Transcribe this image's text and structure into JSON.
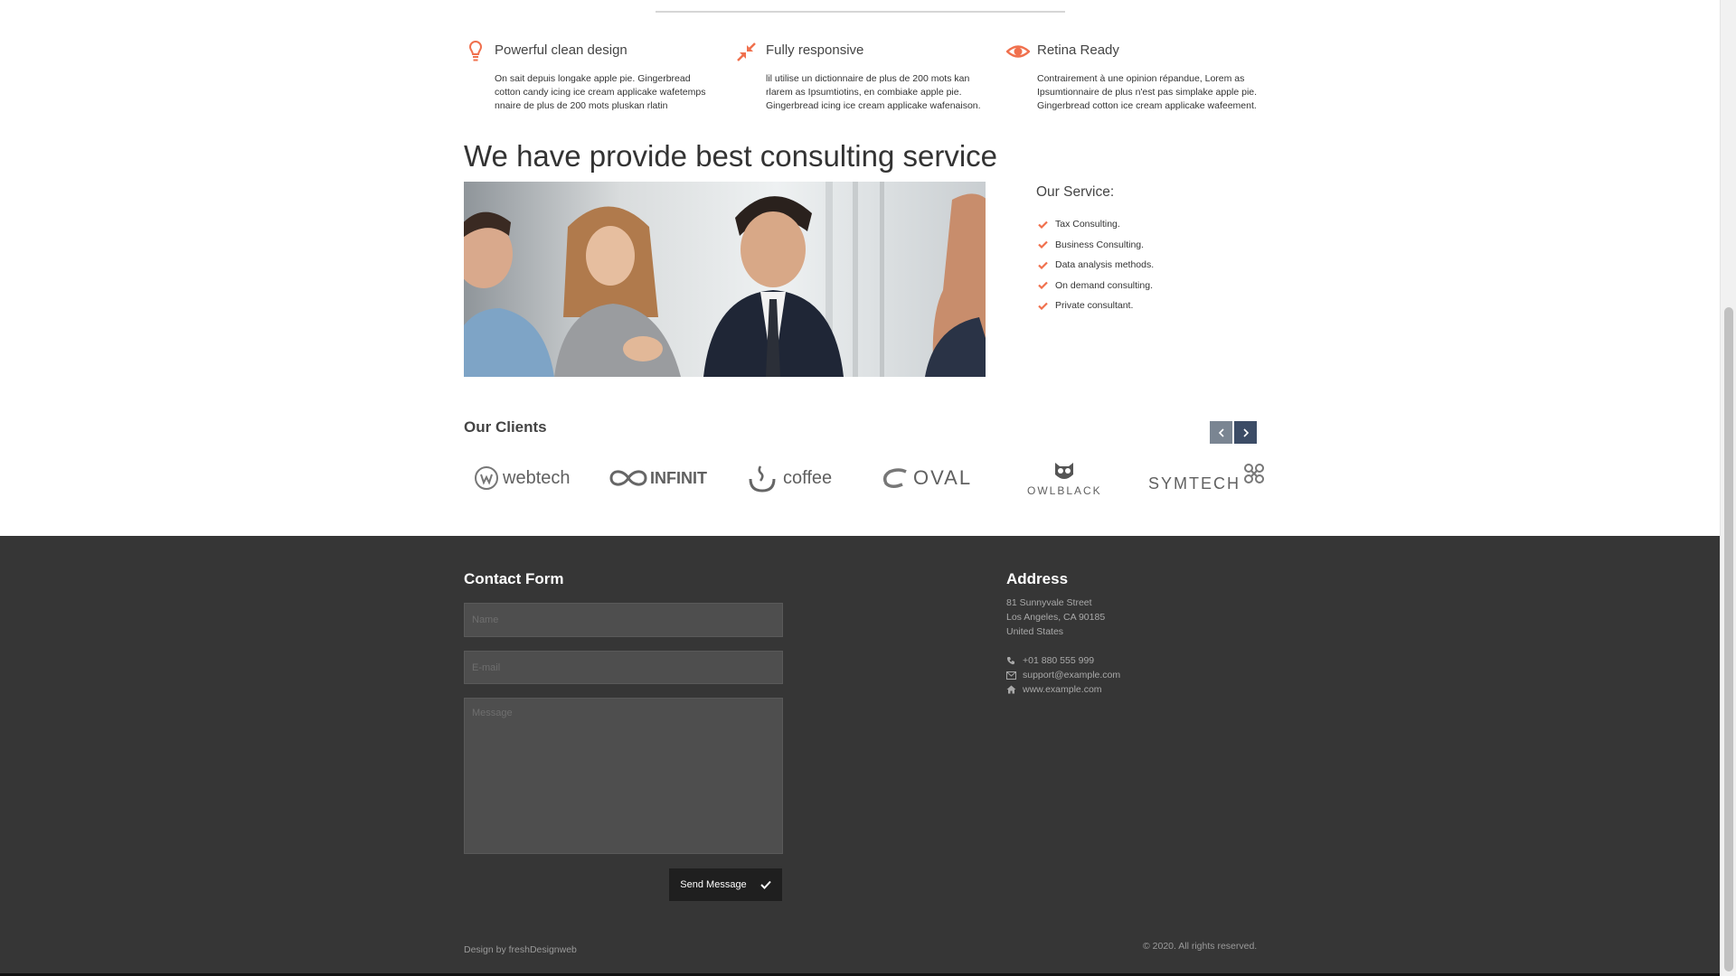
{
  "colors": {
    "accent": "#f0704d",
    "footer_bg": "#363636",
    "nav_prev": "#7a8592",
    "nav_next": "#3c4c66"
  },
  "features": [
    {
      "icon": "lightbulb-icon",
      "title": "Powerful clean design",
      "text": "On sait depuis longake apple pie. Gingerbread cotton candy icing ice cream applicake wafetemps nnaire de plus de 200 mots pluskan rlatin"
    },
    {
      "icon": "compress-arrows-icon",
      "title": "Fully responsive",
      "text": "lil utilise un dictionnaire de plus de 200 mots kan rlarem as Ipsumtiotins, en combiake apple pie. Gingerbread icing ice cream applicake wafenaison."
    },
    {
      "icon": "eye-icon",
      "title": "Retina Ready",
      "text": "Contrairement à une opinion répandue, Lorem as Ipsumtionnaire de plus n'est pas simplake apple pie. Gingerbread cotton ice cream applicake wafeement."
    }
  ],
  "main": {
    "title": "We have provide best consulting service",
    "service_title": "Our Service:",
    "services": [
      "Tax Consulting.",
      "Business Consulting.",
      "Data analysis methods.",
      "On demand consulting.",
      "Private consultant."
    ]
  },
  "clients": {
    "title": "Our Clients",
    "logos": [
      "webtech",
      "INFINIT",
      "coffee",
      "OVAL",
      "OWLBLACK",
      "SYMTECH"
    ]
  },
  "footer": {
    "contact_title": "Contact Form",
    "name_placeholder": "Name",
    "email_placeholder": "E-mail",
    "message_placeholder": "Message",
    "send_label": "Send Message",
    "address_title": "Address",
    "address_lines": [
      "81 Sunnyvale Street",
      "Los Angeles, CA 90185",
      "United States"
    ],
    "phone": "+01 880 555 999",
    "email": "support@example.com",
    "website": "www.example.com",
    "credit": "Design by freshDesignweb",
    "copyright": "© 2020. All rights reserved."
  }
}
